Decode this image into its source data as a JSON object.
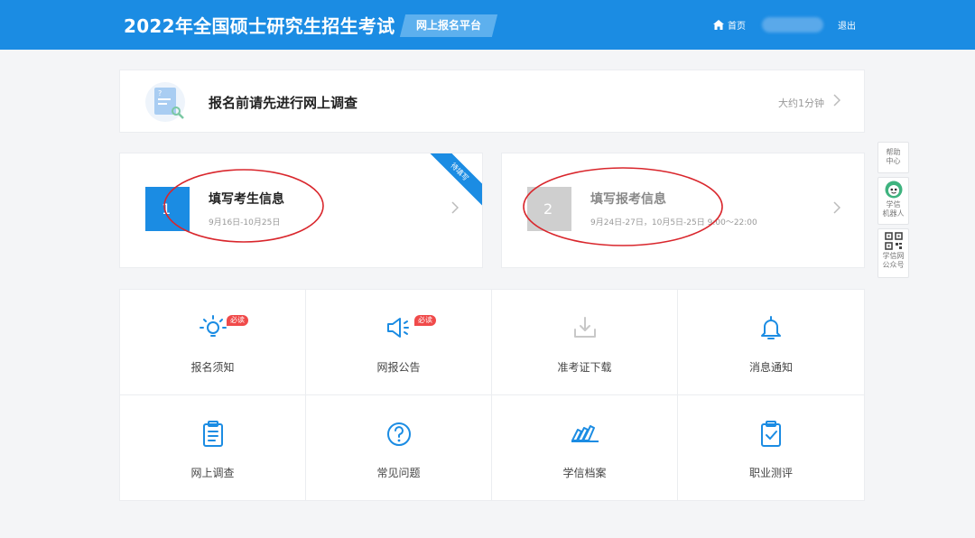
{
  "header": {
    "title": "2022年全国硕士研究生招生考试",
    "platform": "网上报名平台",
    "home_label": "首页",
    "logout_label": "退出"
  },
  "survey": {
    "title": "报名前请先进行网上调查",
    "duration": "大约1分钟"
  },
  "steps": [
    {
      "number": "1",
      "title": "填写考生信息",
      "dates": "9月16日-10月25日",
      "ribbon": "待填写",
      "state": "active"
    },
    {
      "number": "2",
      "title": "填写报考信息",
      "dates": "9月24日-27日，10月5日-25日   9:00～22:00",
      "state": "inactive"
    }
  ],
  "side_tools": [
    {
      "label_line1": "帮助",
      "label_line2": "中心",
      "icon": "help-icon"
    },
    {
      "label_line1": "学信",
      "label_line2": "机器人",
      "icon": "robot-avatar-icon"
    },
    {
      "label_line1": "学信网",
      "label_line2": "公众号",
      "icon": "qrcode-icon"
    }
  ],
  "grid": {
    "items": [
      {
        "label": "报名须知",
        "icon": "lightbulb-icon",
        "badge": "必读"
      },
      {
        "label": "网报公告",
        "icon": "megaphone-icon",
        "badge": "必读"
      },
      {
        "label": "准考证下载",
        "icon": "download-icon"
      },
      {
        "label": "消息通知",
        "icon": "bell-icon"
      },
      {
        "label": "网上调查",
        "icon": "clipboard-list-icon"
      },
      {
        "label": "常见问题",
        "icon": "question-circle-icon"
      },
      {
        "label": "学信档案",
        "icon": "archive-cards-icon"
      },
      {
        "label": "职业测评",
        "icon": "clipboard-check-icon"
      }
    ]
  },
  "colors": {
    "brand_blue": "#1b8ce3",
    "badge_red": "#f04a4a",
    "annotation_red": "#d9262c",
    "disabled_gray": "#cfcfcf"
  }
}
